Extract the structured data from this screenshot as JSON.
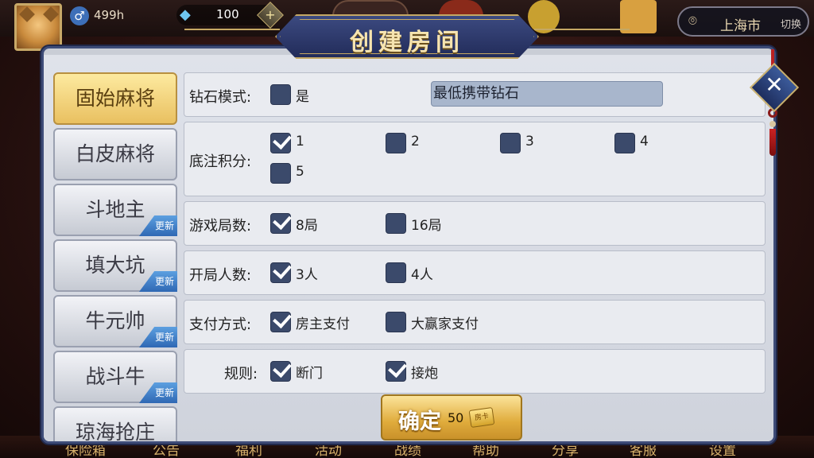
{
  "topbar": {
    "gender_symbol": "♂",
    "hours": "499h",
    "diamonds": "100",
    "plus_symbol": "+",
    "city": "上海市",
    "switch_label": "切换"
  },
  "modal": {
    "title": "创建房间",
    "close_symbol": "✕"
  },
  "games": [
    {
      "label": "固始麻将",
      "active": true,
      "badge": ""
    },
    {
      "label": "白皮麻将",
      "active": false,
      "badge": ""
    },
    {
      "label": "斗地主",
      "active": false,
      "badge": "更新"
    },
    {
      "label": "填大坑",
      "active": false,
      "badge": "更新"
    },
    {
      "label": "牛元帅",
      "active": false,
      "badge": "更新"
    },
    {
      "label": "战斗牛",
      "active": false,
      "badge": "更新"
    },
    {
      "label": "琼海抢庄",
      "active": false,
      "badge": ""
    }
  ],
  "options": {
    "diamond_mode": {
      "label": "钻石模式:",
      "option": "是",
      "checked": false,
      "min_diamond": "最低携带钻石"
    },
    "base_score": {
      "label": "底注积分:",
      "options": [
        {
          "label": "1",
          "checked": true
        },
        {
          "label": "2",
          "checked": false
        },
        {
          "label": "3",
          "checked": false
        },
        {
          "label": "4",
          "checked": false
        },
        {
          "label": "5",
          "checked": false
        }
      ]
    },
    "rounds": {
      "label": "游戏局数:",
      "options": [
        {
          "label": "8局",
          "checked": true
        },
        {
          "label": "16局",
          "checked": false
        }
      ]
    },
    "players": {
      "label": "开局人数:",
      "options": [
        {
          "label": "3人",
          "checked": true
        },
        {
          "label": "4人",
          "checked": false
        }
      ]
    },
    "payment": {
      "label": "支付方式:",
      "options": [
        {
          "label": "房主支付",
          "checked": true
        },
        {
          "label": "大赢家支付",
          "checked": false
        }
      ]
    },
    "rules": {
      "label": "规则:",
      "options": [
        {
          "label": "断门",
          "checked": true
        },
        {
          "label": "接炮",
          "checked": true
        }
      ]
    }
  },
  "confirm": {
    "label": "确定",
    "cost": "50",
    "card_icon_text": "房卡"
  },
  "bottom_nav": [
    "保险箱",
    "公告",
    "福利",
    "活动",
    "战绩",
    "帮助",
    "分享",
    "客服",
    "设置"
  ],
  "colors": {
    "accent": "#3e4c78",
    "checkbox": "#3b4a6b",
    "active_tab": "#e9c060",
    "badge": "#2f68b4"
  }
}
